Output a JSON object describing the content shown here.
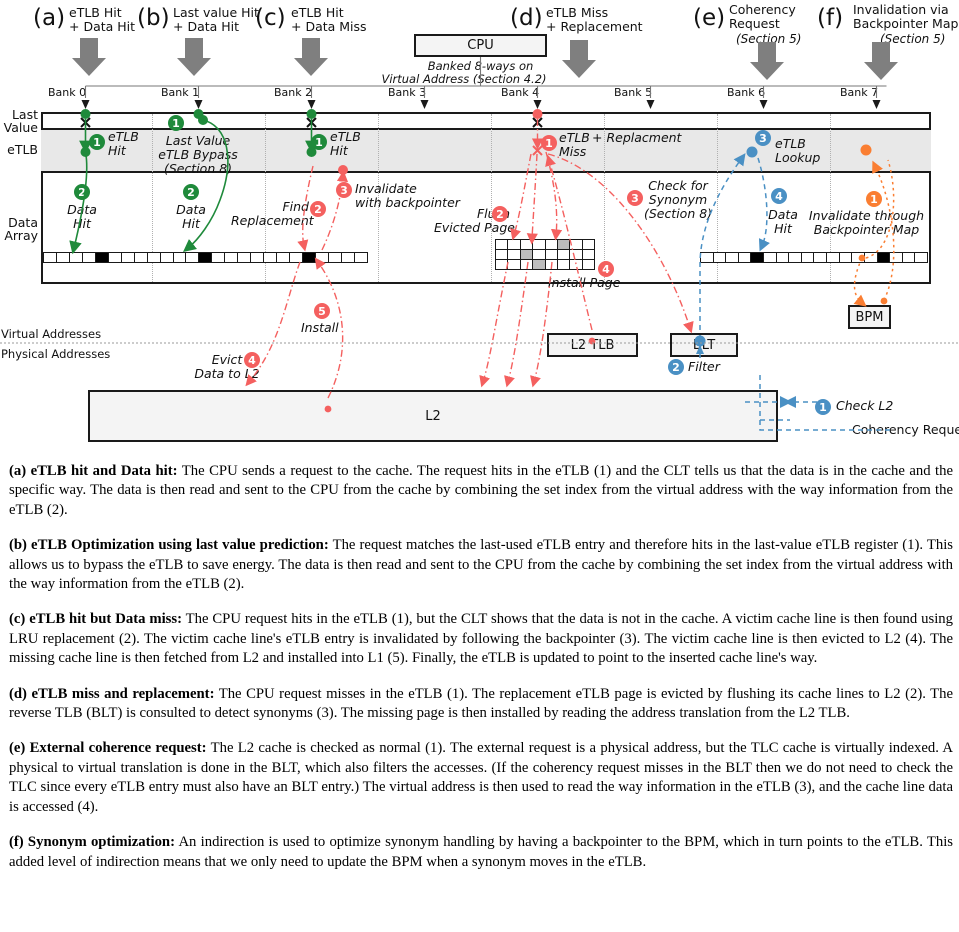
{
  "cases": [
    {
      "tag": "(a)",
      "line1": "eTLB Hit",
      "line2": "+ Data Hit",
      "sec": ""
    },
    {
      "tag": "(b)",
      "line1": "Last value Hit",
      "line2": "+ Data Hit",
      "sec": ""
    },
    {
      "tag": "(c)",
      "line1": "eTLB Hit",
      "line2": "+ Data Miss",
      "sec": ""
    },
    {
      "tag": "(d)",
      "line1": "eTLB Miss",
      "line2": "+ Replacement",
      "sec": ""
    },
    {
      "tag": "(e)",
      "line1": "Coherency",
      "line2": "Request",
      "sec": "(Section 5)"
    },
    {
      "tag": "(f)",
      "line1": "Invalidation via",
      "line2": "Backpointer Map",
      "sec": "(Section 5)"
    }
  ],
  "cpu": {
    "label": "CPU",
    "note1": "Banked 8-ways on",
    "note2": "Virtual Address (Section 4.2)"
  },
  "banks": [
    "Bank 0",
    "Bank 1",
    "Bank 2",
    "Bank 3",
    "Bank 4",
    "Bank 5",
    "Bank 6",
    "Bank 7"
  ],
  "rows": {
    "last_value_1": "Last",
    "last_value_2": "Value",
    "etlb": "eTLB",
    "data_1": "Data",
    "data_2": "Array"
  },
  "address_lines": {
    "virtual": "Virtual Addresses",
    "physical": "Physical Addresses"
  },
  "boxes": {
    "l2tlb": "L2 TLB",
    "blt": "BLT",
    "bpm": "BPM",
    "l2": "L2"
  },
  "annotations": [
    {
      "num": "1",
      "color": "green",
      "text": "eTLB\nHit"
    },
    {
      "num": "2",
      "color": "green",
      "text": "Data\nHit"
    },
    {
      "num": "1",
      "color": "green",
      "text": "Last Value\neTLB Bypass\n(Section 8)"
    },
    {
      "num": "2",
      "color": "green",
      "text": "Data\nHit"
    },
    {
      "num": "1",
      "color": "green",
      "text": "eTLB\nHit"
    },
    {
      "num": "2",
      "color": "red",
      "text": "Find\nReplacement"
    },
    {
      "num": "3",
      "color": "red",
      "text": "Invalidate\nwith backpointer"
    },
    {
      "num": "4",
      "color": "red",
      "text": "Evict\nData to L2"
    },
    {
      "num": "5",
      "color": "red",
      "text": "Install"
    },
    {
      "num": "1",
      "color": "red",
      "text": "eTLB\nMiss + Replacment"
    },
    {
      "num": "2",
      "color": "red",
      "text": "Flush\nEvicted Page"
    },
    {
      "num": "3",
      "color": "red",
      "text": "Check for\nSynonym\n(Section 8)"
    },
    {
      "num": "4",
      "color": "red",
      "text": "Install Page"
    },
    {
      "num": "1",
      "color": "blue",
      "text": "Check L2"
    },
    {
      "num": "2",
      "color": "blue",
      "text": "Filter"
    },
    {
      "num": "3",
      "color": "blue",
      "text": "eTLB\nLookup"
    },
    {
      "num": "4",
      "color": "blue",
      "text": "Data\nHit"
    },
    {
      "num": "1",
      "color": "orange",
      "text": "Invalidate through\nBackpointer Map"
    }
  ],
  "labels": {
    "a1": "eTLB",
    "a1b": "Hit",
    "a2": "Data",
    "a2b": "Hit",
    "b1": "Last Value",
    "b1b": "eTLB Bypass",
    "b1c": "(Section 8)",
    "b2": "Data",
    "b2b": "Hit",
    "c1": "eTLB",
    "c1b": "Hit",
    "c2": "Find",
    "c2b": "Replacement",
    "c3": "Invalidate",
    "c3b": "with backpointer",
    "c4": "Evict",
    "c4b": "Data to L2",
    "c5": "Install",
    "d1": "eTLB",
    "d1b": "Miss",
    "d1c": "+ Replacment",
    "d2": "Flush",
    "d2b": "Evicted Page",
    "d3": "Check for",
    "d3b": "Synonym",
    "d3c": "(Section 8)",
    "d4": "Install Page",
    "e1": "Check L2",
    "e1b": "Coherency Request",
    "e2": "Filter",
    "e3": "eTLB",
    "e3b": "Lookup",
    "e4": "Data",
    "e4b": "Hit",
    "f1": "Invalidate through",
    "f1b": "Backpointer Map"
  },
  "colors": {
    "green": "#1f8a3b",
    "red": "#f4605f",
    "blue": "#4a90c4",
    "orange": "#fa7e32",
    "grey_arrow": "#7f7f7f",
    "band": "#e8e8e8",
    "box_fill": "#f4f4f4",
    "stroke": "#1a1a1a"
  },
  "caption": [
    {
      "title": "(a) eTLB hit and Data hit:",
      "body": "The CPU sends a request to the cache. The request hits in the eTLB (1) and the CLT tells us that the data is in the cache and the specific way. The data is then read and sent to the CPU from the cache by combining the set index from the virtual address with the way information from the eTLB (2)."
    },
    {
      "title": "(b) eTLB Optimization using last value prediction:",
      "body": "The request matches the last-used eTLB entry and therefore hits in the last-value eTLB register (1). This allows us to bypass the eTLB to save energy.  The data is then read and sent to the CPU from the cache by combining the set index from the virtual address with the way information from the eTLB (2)."
    },
    {
      "title": "(c) eTLB hit but Data miss:",
      "body": "The CPU request hits in the eTLB (1), but the CLT shows that the data is not in the cache. A victim cache line is then found using LRU replacement (2). The victim cache line's eTLB entry is invalidated by following the backpointer (3). The victim cache line is then evicted to L2 (4). The missing cache line is then fetched from L2 and installed into L1 (5). Finally, the eTLB is updated to point to the inserted cache line's way."
    },
    {
      "title": "(d) eTLB miss and replacement:",
      "body": "The CPU request misses in the eTLB (1). The replacement eTLB page is evicted by flushing its cache lines to L2 (2). The reverse TLB (BLT) is consulted to detect synonyms (3). The missing page is then installed by reading the address translation from the L2 TLB."
    },
    {
      "title": "(e) External coherence request:",
      "body": "The L2 cache is checked as normal (1). The external request is a physical address, but the TLC cache is virtually indexed. A physical to virtual translation is done in the BLT, which also filters the accesses. (If the coherency request misses in the BLT then we do not need to check the TLC since every eTLB entry must also have an BLT entry.) The virtual address is then used to read the way information in the eTLB (3), and the cache line data is accessed (4)."
    },
    {
      "title": "(f) Synonym optimization:",
      "body": "An indirection is used to optimize synonym handling by having a backpointer to the BPM, which in turn points to the eTLB. This added level of indirection means that we only need to update the BPM when a synonym moves in the eTLB."
    }
  ]
}
